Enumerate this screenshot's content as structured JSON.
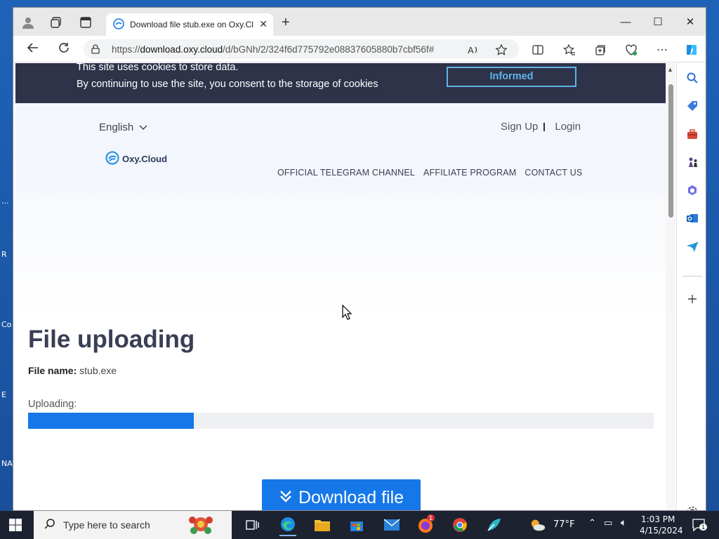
{
  "desktop": {
    "labels": [
      "...",
      "R",
      "Co",
      "E",
      "NA"
    ]
  },
  "browser": {
    "tab_title": "Download file stub.exe on Oxy.Cl",
    "url_prefix": "https://",
    "url_domain": "download.oxy.cloud",
    "url_path": "/d/bGNh/2/324f6d775792e08837605880b7cbf56f#",
    "window_controls": {
      "minimize": "—",
      "maximize": "☐",
      "close": "✕"
    }
  },
  "cookie_banner": {
    "line1": "This site uses cookies to store data.",
    "line2": "By continuing to use the site, you consent to the storage of cookies",
    "button": "Informed"
  },
  "header": {
    "language": "English",
    "sign_up": "Sign Up",
    "login": "Login",
    "logo": "Oxy.Cloud",
    "nav": [
      "OFFICIAL TELEGRAM CHANNEL",
      "AFFILIATE PROGRAM",
      "CONTACT US"
    ]
  },
  "main": {
    "title": "File uploading",
    "file_name_label": "File name:",
    "file_name": "stub.exe",
    "uploading_label": "Uploading:",
    "progress_fraction": 0.265,
    "download_button": "Download file"
  },
  "taskbar": {
    "search_placeholder": "Type here to search",
    "weather": "77°F",
    "time": "1:03 PM",
    "date": "4/15/2024",
    "notification_count": "1",
    "firefox_badge": "1"
  },
  "colors": {
    "accent": "#1577e8",
    "banner": "#2e3349",
    "outline": "#5fb3e8"
  }
}
